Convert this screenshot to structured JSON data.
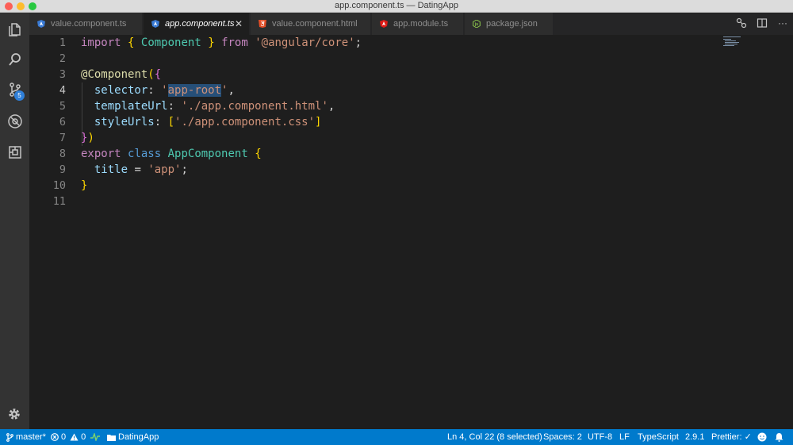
{
  "window": {
    "title": "app.component.ts — DatingApp"
  },
  "activity": {
    "scm_badge": "5"
  },
  "tabs": [
    {
      "label": "value.component.ts",
      "icon": "angular-icon",
      "color": "#3a7bd5"
    },
    {
      "label": "app.component.ts",
      "icon": "angular-icon",
      "color": "#3a7bd5",
      "active": true
    },
    {
      "label": "value.component.html",
      "icon": "html5-icon",
      "color": "#e44d26"
    },
    {
      "label": "app.module.ts",
      "icon": "angular-icon",
      "color": "#dd1b16"
    },
    {
      "label": "package.json",
      "icon": "nodejs-icon",
      "color": "#8cc84b"
    }
  ],
  "editor": {
    "line_numbers": [
      "1",
      "2",
      "3",
      "4",
      "5",
      "6",
      "7",
      "8",
      "9",
      "10",
      "11"
    ],
    "current_line": 4,
    "code": {
      "l1": {
        "import": "import",
        "ob": "{",
        "name": "Component",
        "cb": "}",
        "from": "from",
        "module": "'@angular/core'",
        "semi": ";"
      },
      "l3": {
        "at": "@",
        "dec": "Component",
        "paren": "(",
        "brace": "{"
      },
      "l4": {
        "key": "selector",
        "colon": ":",
        "q1": "'",
        "val": "app-root",
        "q2": "'",
        "comma": ","
      },
      "l5": {
        "key": "templateUrl",
        "colon": ":",
        "val": "'./app.component.html'",
        "comma": ","
      },
      "l6": {
        "key": "styleUrls",
        "colon": ":",
        "ob": "[",
        "val": "'./app.component.css'",
        "cb": "]"
      },
      "l7": {
        "brace": "}",
        "paren": ")"
      },
      "l8": {
        "export": "export",
        "class": "class",
        "name": "AppComponent",
        "brace": "{"
      },
      "l9": {
        "key": "title",
        "eq": "=",
        "val": "'app'",
        "semi": ";"
      },
      "l10": {
        "brace": "}"
      }
    }
  },
  "status": {
    "branch": "master*",
    "errors": "0",
    "warnings": "0",
    "folder": "DatingApp",
    "cursor": "Ln 4, Col 22 (8 selected)",
    "spaces": "Spaces: 2",
    "encoding": "UTF-8",
    "eol": "LF",
    "language": "TypeScript",
    "version": "2.9.1",
    "prettier": "Prettier: ✓"
  }
}
